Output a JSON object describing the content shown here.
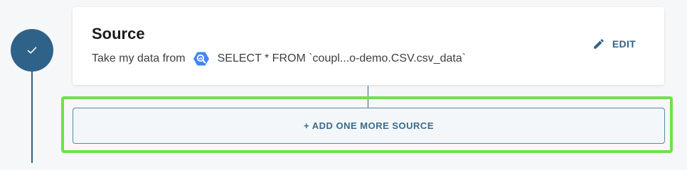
{
  "step": {
    "status_icon": "check-icon",
    "status_color": "#2f6288"
  },
  "source_card": {
    "title": "Source",
    "desc_prefix": "Take my data from",
    "source_icon": "bigquery-icon",
    "query_text": "SELECT * FROM `coupl...o-demo.CSV.csv_data`",
    "edit_icon": "pencil-icon",
    "edit_label": "EDIT"
  },
  "add_source": {
    "label": "+ ADD ONE MORE SOURCE",
    "highlight_color": "#6fe14a"
  },
  "colors": {
    "accent": "#2f6288",
    "background": "#f5f7f8",
    "bigquery": "#4386fa"
  }
}
